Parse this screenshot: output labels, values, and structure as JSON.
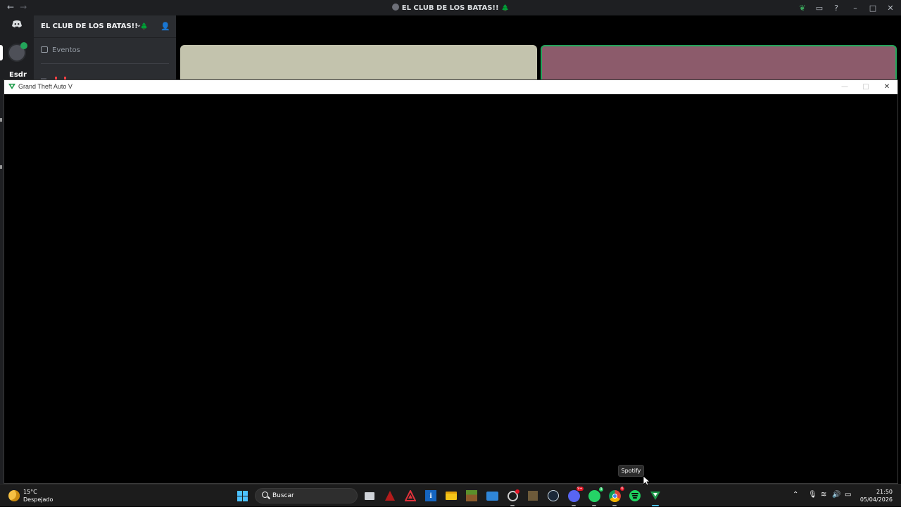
{
  "discord": {
    "window_title": "EL CLUB DE LOS BATAS!!",
    "title_decoration": "🌲",
    "server_name": "EL CLUB DE LOS BATAS!!",
    "server_decoration": "🌲",
    "events_label": "Eventos",
    "user_name_partial": "Esdr",
    "icons": [
      "discord-icon",
      "back-arrow-icon",
      "forward-arrow-icon",
      "leaf-icon",
      "inbox-icon",
      "help-icon",
      "add-member-icon",
      "calendar-icon",
      "speaker-icon"
    ],
    "tile_colors": [
      "#c3c3ad",
      "#8c5b6b"
    ],
    "speaking_color": "#23a55a"
  },
  "gta_window": {
    "title": "Grand Theft Auto V",
    "logo_color": "#1e9b4a"
  },
  "taskbar": {
    "weather": {
      "temp": "15°C",
      "condition": "Despejado"
    },
    "search_label": "Buscar",
    "apps": [
      {
        "name": "task-view-icon"
      },
      {
        "name": "red-app-icon"
      },
      {
        "name": "warning-app-icon"
      },
      {
        "name": "info-app-icon"
      },
      {
        "name": "file-explorer-icon"
      },
      {
        "name": "minecraft-icon"
      },
      {
        "name": "photos-icon"
      },
      {
        "name": "rockstar-launcher-icon"
      },
      {
        "name": "minecraft-block-icon"
      },
      {
        "name": "steam-icon"
      },
      {
        "name": "discord-taskbar-icon",
        "badge": "9+"
      },
      {
        "name": "whatsapp-icon",
        "badge": "3"
      },
      {
        "name": "chrome-icon",
        "badge": "6"
      },
      {
        "name": "spotify-icon"
      },
      {
        "name": "gta-v-icon"
      }
    ],
    "tooltip": "Spotify",
    "clock": {
      "time": "21:50",
      "date": "05/04/2026"
    }
  }
}
